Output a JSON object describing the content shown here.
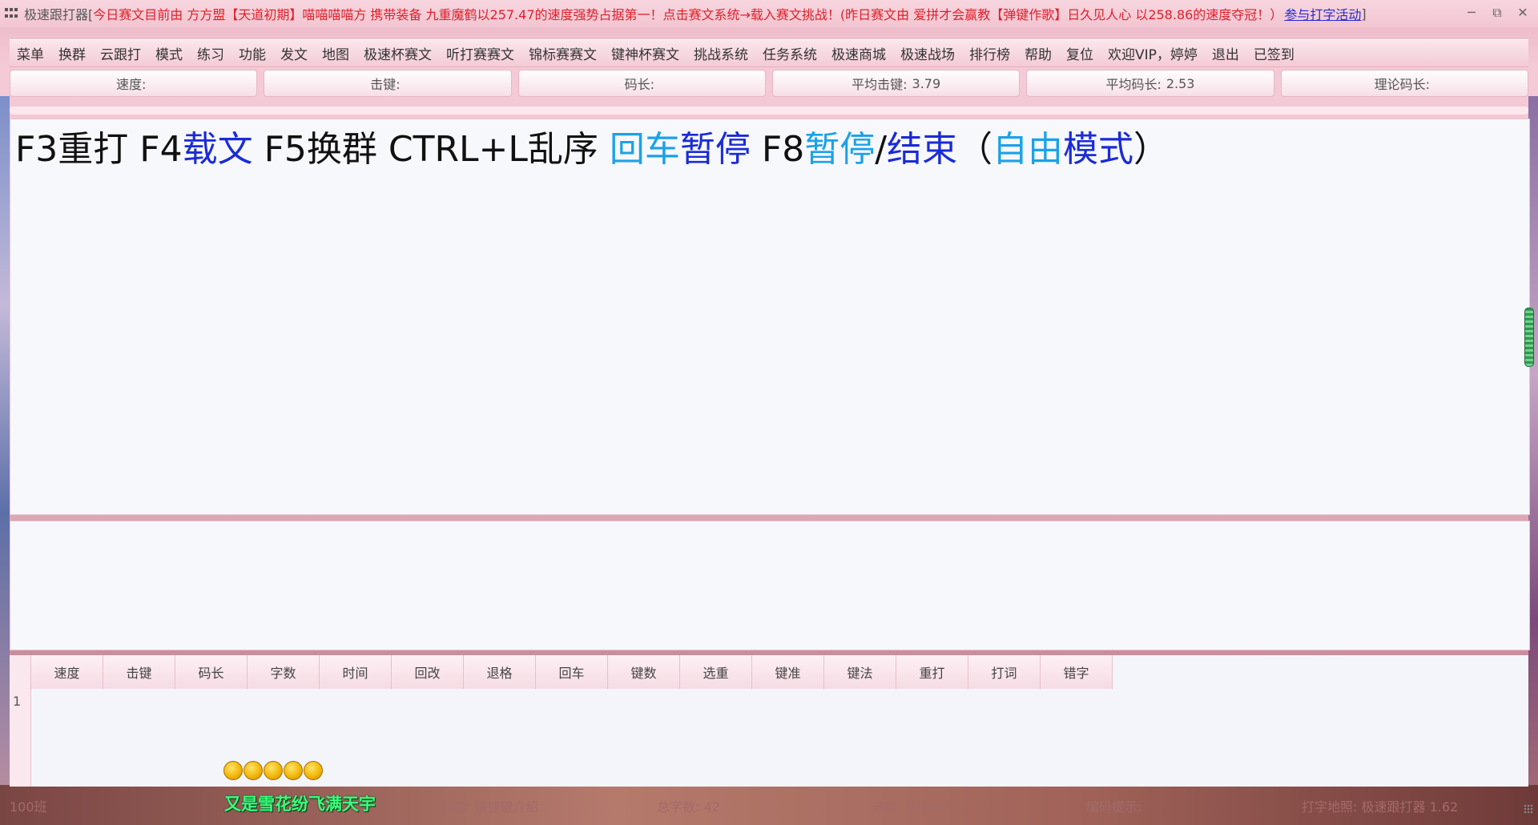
{
  "titlebar": {
    "app_name": "极速跟打器[",
    "notice": "今日赛文目前由 方方盟【天道初期】喵喵喵喵方 携带装备 九重魔鹤以257.47的速度强势占据第一！点击赛文系统→载入赛文挑战！(昨日赛文由 爱拼才会赢教【弹键作歌】日久见人心 以258.86的速度夺冠！）",
    "link": "参与打字活动",
    "close_bracket": "]",
    "window_buttons": [
      "minimize-icon",
      "restore-icon",
      "close-icon"
    ]
  },
  "menu": [
    "菜单",
    "换群",
    "云跟打",
    "模式",
    "练习",
    "功能",
    "发文",
    "地图",
    "极速杯赛文",
    "听打赛赛文",
    "锦标赛赛文",
    "键神杯赛文",
    "挑战系统",
    "任务系统",
    "极速商城",
    "极速战场",
    "排行榜",
    "帮助",
    "复位",
    "欢迎VIP，婷婷",
    "退出",
    "已签到"
  ],
  "stats": [
    {
      "label": "速度:",
      "value": ""
    },
    {
      "label": "击键:",
      "value": ""
    },
    {
      "label": "码长:",
      "value": ""
    },
    {
      "label": "平均击键:",
      "value": "3.79"
    },
    {
      "label": "平均码长:",
      "value": "2.53"
    },
    {
      "label": "理论码长:",
      "value": ""
    }
  ],
  "display": {
    "segments": [
      {
        "text": "F3重打 F4",
        "color": "black"
      },
      {
        "text": "载文",
        "color": "blue"
      },
      {
        "text": " F5换群 CTRL+L乱序 ",
        "color": "black"
      },
      {
        "text": "回车",
        "color": "cyan"
      },
      {
        "text": "暂停",
        "color": "blue"
      },
      {
        "text": " F8",
        "color": "black"
      },
      {
        "text": "暂停",
        "color": "cyan"
      },
      {
        "text": "/",
        "color": "black"
      },
      {
        "text": "结束",
        "color": "blue"
      },
      {
        "text": "（",
        "color": "black"
      },
      {
        "text": "自由",
        "color": "cyan"
      },
      {
        "text": "模式",
        "color": "blue"
      },
      {
        "text": "）",
        "color": "black"
      }
    ]
  },
  "results": {
    "columns": [
      "速度",
      "击键",
      "码长",
      "字数",
      "时间",
      "回改",
      "退格",
      "回车",
      "键数",
      "选重",
      "键准",
      "键法",
      "重打",
      "打词",
      "错字"
    ],
    "row_numbers": [
      "1"
    ]
  },
  "status": {
    "coins_count": 5,
    "song": "又是雪花纷飞满天宇",
    "left": "100班",
    "title": "标题: 快捷键介绍",
    "total": "总字数: 42",
    "progress": "进度: 0.00%",
    "hint": "编码提示:",
    "right": "打字地照: 极速跟打器 1.62"
  },
  "colors": {
    "black": "#111111",
    "blue": "#1a2bd6",
    "cyan": "#1ba2e8",
    "notice": "#e0202a",
    "link": "#2a2ad0"
  }
}
